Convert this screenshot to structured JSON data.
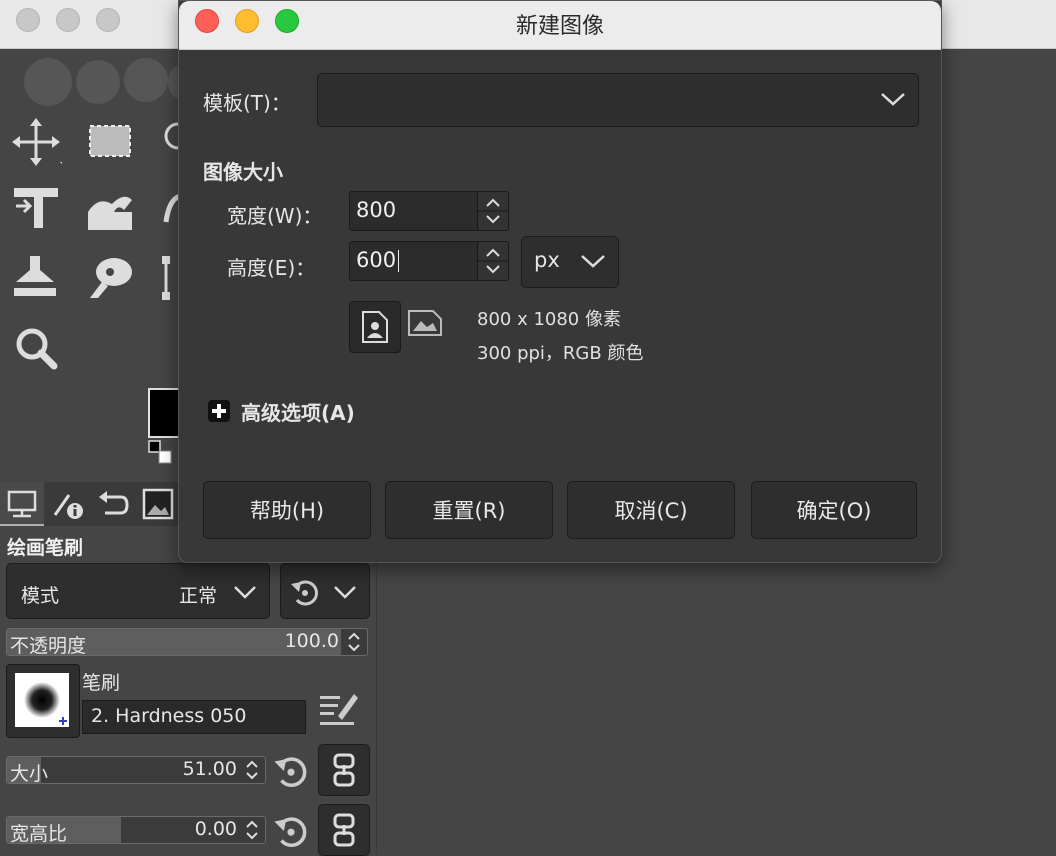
{
  "dialog": {
    "title": "新建图像",
    "template_label": "模板(T)：",
    "template_value": "",
    "image_size_heading": "图像大小",
    "width_label": "宽度(W)：",
    "width_value": "800",
    "height_label": "高度(E)：",
    "height_value": "600",
    "unit": "px",
    "dimensions_info": "800 x 1080 像素",
    "resolution_info": "300 ppi，RGB 颜色",
    "advanced_label": "高级选项(A)",
    "buttons": {
      "help": "帮助(H)",
      "reset": "重置(R)",
      "cancel": "取消(C)",
      "ok": "确定(O)"
    }
  },
  "tool_options": {
    "title": "绘画笔刷",
    "mode_label": "模式",
    "mode_value": "正常",
    "opacity_label": "不透明度",
    "opacity_value": "100.0",
    "opacity_fraction": 1.0,
    "brush_label": "笔刷",
    "brush_name": "2. Hardness 050",
    "size_label": "大小",
    "size_value": "51.00",
    "aspect_label": "宽高比",
    "aspect_value": "0.00"
  },
  "colors": {
    "foreground": "#000000",
    "background": "#ffffff",
    "close": "#ff5f57",
    "minimize": "#febc2e",
    "zoom": "#28c840"
  },
  "icons": [
    "move-tool-icon",
    "rect-select-tool-icon",
    "lasso-tool-icon",
    "crop-tool-icon",
    "warp-tool-icon",
    "paint-tool-icon",
    "clone-tool-icon",
    "smudge-tool-icon",
    "path-tool-icon",
    "zoom-tool-icon"
  ]
}
